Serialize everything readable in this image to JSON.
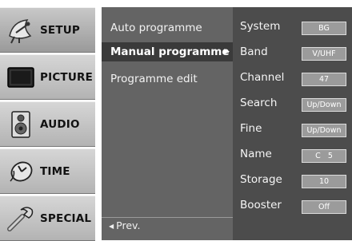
{
  "categories": [
    {
      "label": "SETUP",
      "icon": "satellite-dish-icon",
      "active": true
    },
    {
      "label": "PICTURE",
      "icon": "tv-screen-icon",
      "active": false
    },
    {
      "label": "AUDIO",
      "icon": "speaker-icon",
      "active": false
    },
    {
      "label": "TIME",
      "icon": "clock-icon",
      "active": false
    },
    {
      "label": "SPECIAL",
      "icon": "wrench-icon",
      "active": false
    }
  ],
  "submenu": {
    "items": [
      {
        "label": "Auto programme"
      },
      {
        "label": "Manual programme",
        "selected": true,
        "arrow": "▶"
      },
      {
        "label": "Programme edit"
      }
    ],
    "prev_label": "Prev.",
    "prev_arrow": "◀"
  },
  "settings": [
    {
      "label": "System",
      "value": "BG"
    },
    {
      "label": "Band",
      "value": "V/UHF"
    },
    {
      "label": "Channel",
      "value": "47"
    },
    {
      "label": "Search",
      "value": "Up/Down"
    },
    {
      "label": "Fine",
      "value": "Up/Down"
    },
    {
      "label": "Name",
      "value": "C   5"
    },
    {
      "label": "Storage",
      "value": "10"
    },
    {
      "label": "Booster",
      "value": "Off"
    }
  ],
  "colors": {
    "category_bg": "#c4c4c4",
    "submenu_bg": "#646464",
    "submenu_selected_bg": "#3a3a3a",
    "settings_bg": "#4c4c4c",
    "value_box_bg": "#9b9b9b"
  }
}
